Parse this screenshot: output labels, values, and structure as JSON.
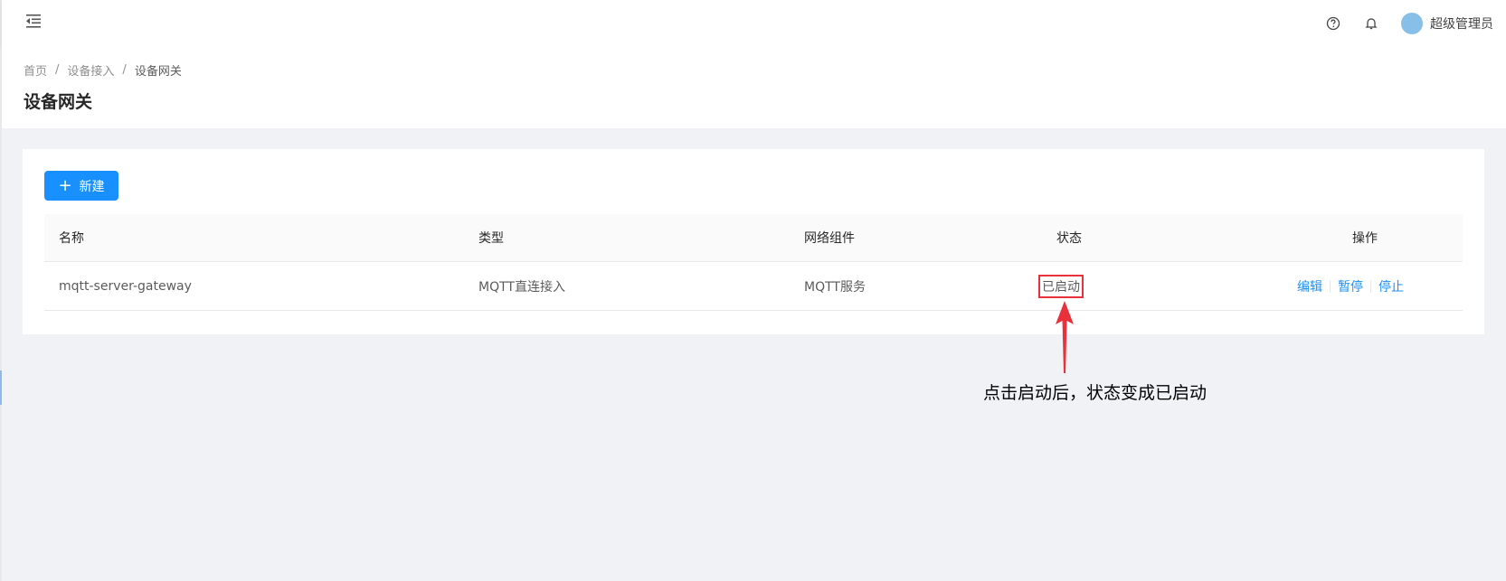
{
  "header": {
    "menu_icon": "menu-fold-icon",
    "help_icon": "question-circle-icon",
    "bell_icon": "bell-icon",
    "username": "超级管理员",
    "avatar_color": "#87bfe8"
  },
  "breadcrumb": {
    "items": [
      "首页",
      "设备接入",
      "设备网关"
    ],
    "separator": "/"
  },
  "page": {
    "title": "设备网关"
  },
  "toolbar": {
    "new_label": "新建",
    "new_icon": "plus-icon"
  },
  "table": {
    "columns": [
      "名称",
      "类型",
      "网络组件",
      "状态",
      "操作"
    ],
    "rows": [
      {
        "name": "mqtt-server-gateway",
        "type": "MQTT直连接入",
        "network": "MQTT服务",
        "status": "已启动",
        "actions": [
          "编辑",
          "暂停",
          "停止"
        ]
      }
    ]
  },
  "annotation": {
    "text": "点击启动后，状态变成已启动",
    "color": "#e8313a"
  },
  "colors": {
    "primary": "#1890ff",
    "highlight": "#e8313a",
    "background": "#f0f2f5"
  }
}
